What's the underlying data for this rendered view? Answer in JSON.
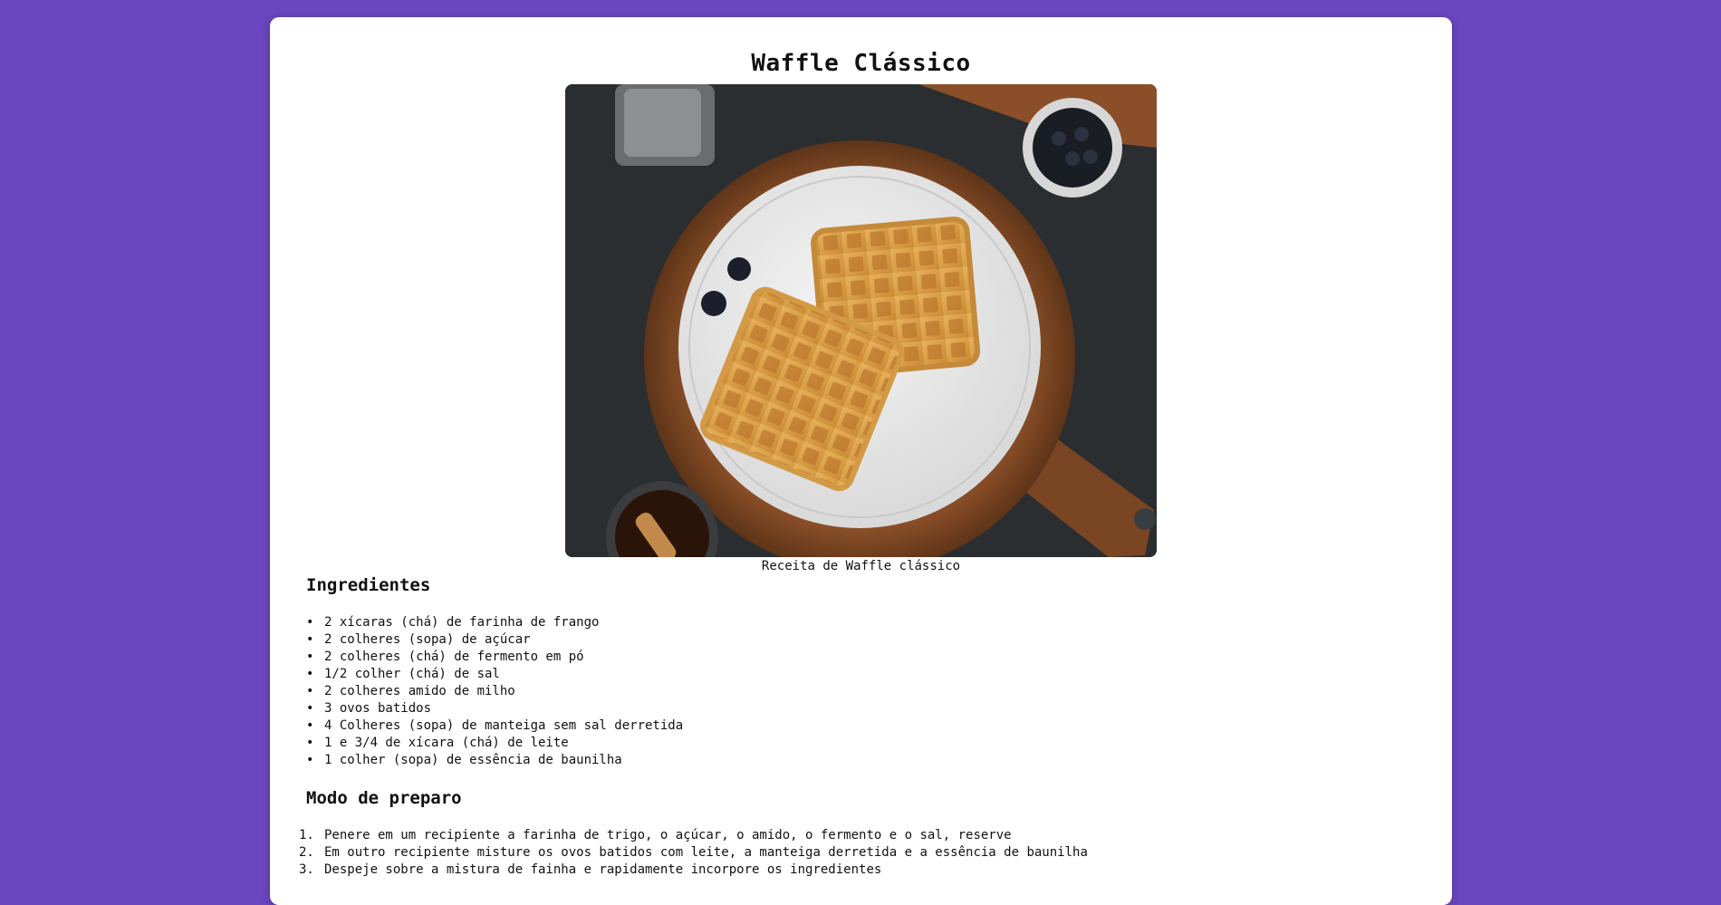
{
  "page": {
    "title": "Waffle Clássico",
    "caption": "Receita de Waffle clássico",
    "image_alt": "Waffle clássico"
  },
  "ingredients": {
    "heading": "Ingredientes",
    "items": [
      "2 xícaras (chá) de farinha de frango",
      "2 colheres (sopa) de açúcar",
      "2 colheres (chá) de fermento em pó",
      "1/2 colher (chá) de sal",
      "2 colheres amido de milho",
      "3 ovos batidos",
      "4 Colheres (sopa) de manteiga sem sal derretida",
      "1 e 3/4 de xícara (chá) de leite",
      "1 colher (sopa) de essência de baunilha"
    ]
  },
  "method": {
    "heading": "Modo de preparo",
    "steps": [
      "Penere em um recipiente a farinha de trigo, o açúcar, o amido, o fermento e o sal, reserve",
      "Em outro recipiente misture os ovos batidos com leite, a manteiga derretida e a essência de baunilha",
      "Despeje sobre a mistura de fainha e rapidamente incorpore os ingredientes"
    ]
  },
  "colors": {
    "background": "#6b46c1",
    "card": "#ffffff",
    "text": "#111111"
  }
}
